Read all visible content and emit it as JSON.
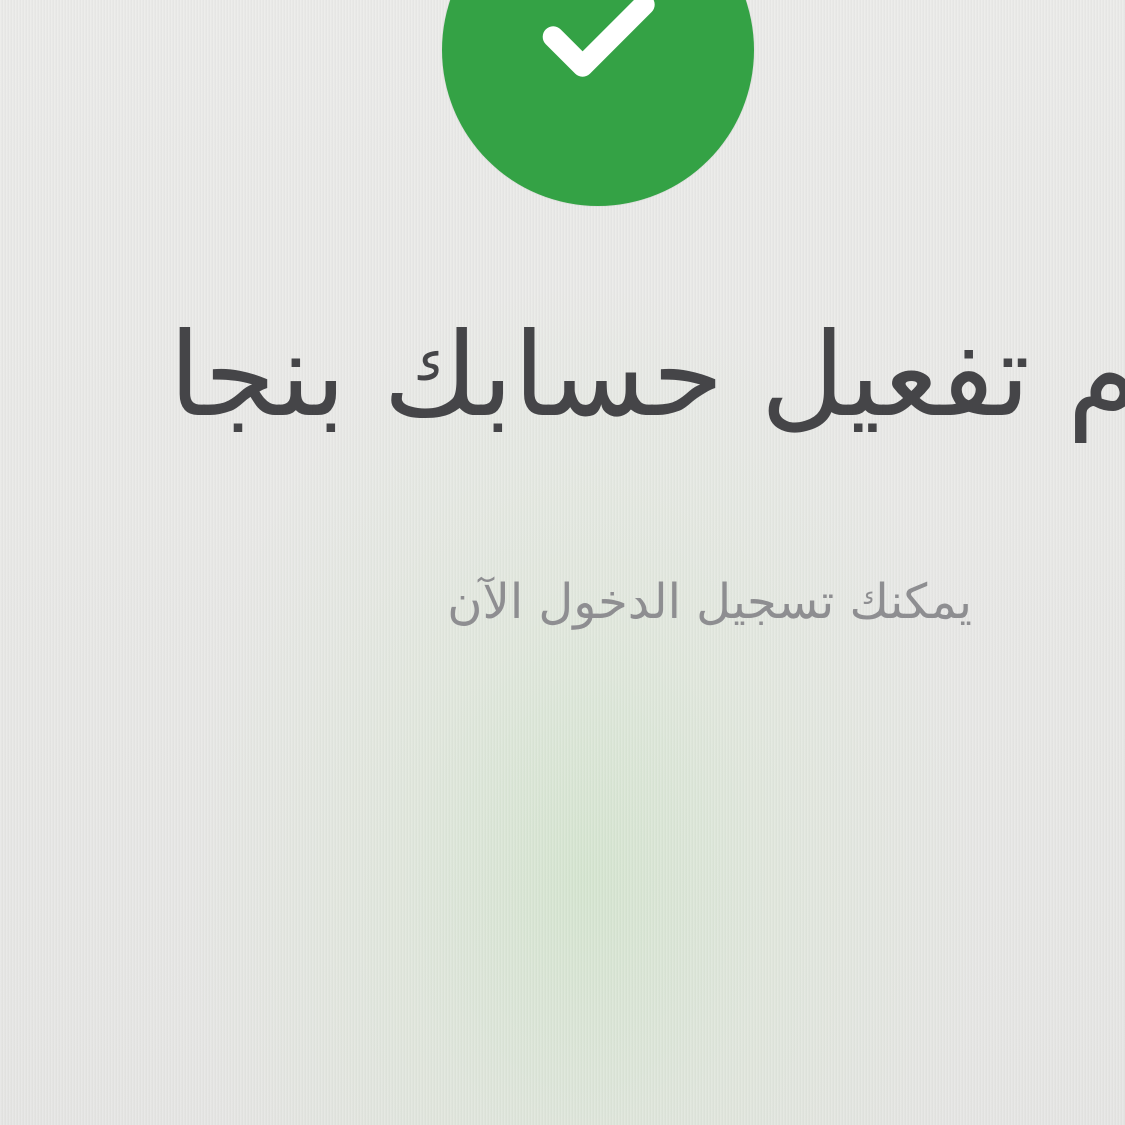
{
  "success_screen": {
    "icon": "check-circle-icon",
    "accent_color": "#34a245",
    "headline": "م تفعيل حسابك بنجا",
    "subtitle": "يمكنك تسجيل الدخول الآن"
  }
}
